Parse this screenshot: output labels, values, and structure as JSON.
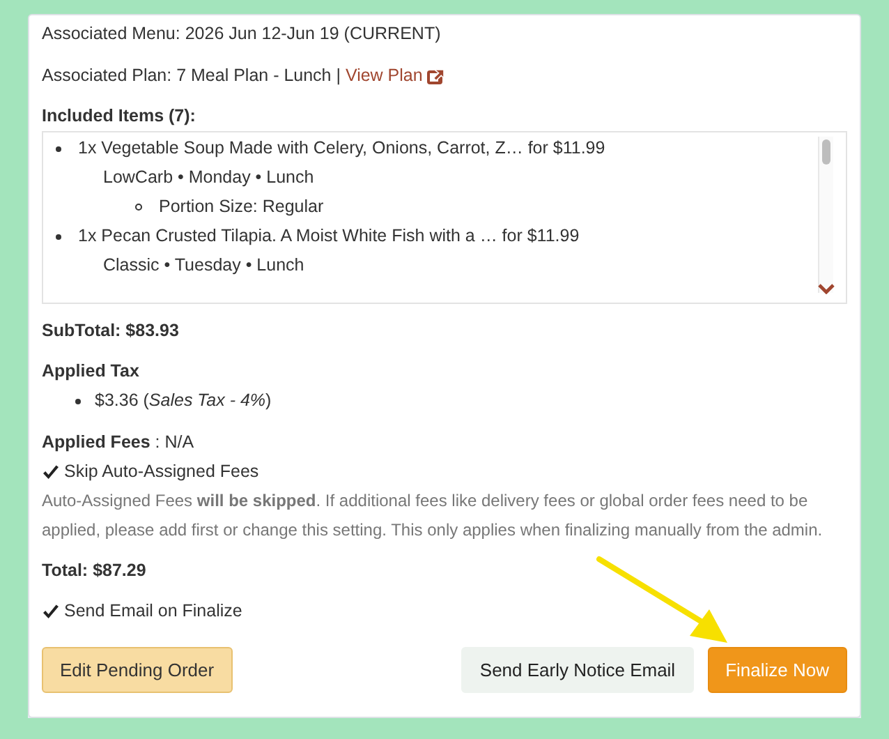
{
  "associated_menu": "Associated Menu: 2026 Jun 12-Jun 19 (CURRENT)",
  "associated_plan": {
    "text": "Associated Plan: 7 Meal Plan - Lunch |",
    "link": "View Plan"
  },
  "included_items": {
    "heading": "Included Items (7):",
    "items": [
      {
        "text": "1x Vegetable Soup Made with Celery, Onions, Carrot, Z… for $11.99",
        "details": "LowCarb • Monday • Lunch",
        "options": [
          "Portion Size: Regular"
        ]
      },
      {
        "text": "1x Pecan Crusted Tilapia. A Moist White Fish with a … for $11.99",
        "details": "Classic • Tuesday • Lunch"
      }
    ]
  },
  "subtotal": "SubTotal: $83.93",
  "applied_tax": {
    "heading": "Applied Tax",
    "items": [
      "$3.36 (*Sales Tax - 4%*)"
    ]
  },
  "applied_fees": "**Applied Fees** : N/A",
  "skip_fees": {
    "label": "Skip Auto-Assigned Fees",
    "checked": true
  },
  "skip_fees_note": "Auto-Assigned Fees **will be skipped**. If additional fees like delivery fees or global order fees need to be applied, please add first or change this setting. This only applies when finalizing manually from the admin.",
  "total": "Total: $87.29",
  "send_email": {
    "label": "Send Email on Finalize",
    "checked": true
  },
  "buttons": [
    {
      "label": "Edit Pending Order",
      "kind": "edit"
    },
    {
      "label": "Send Early Notice Email",
      "kind": "secondary"
    },
    {
      "label": "Finalize Now",
      "kind": "primary"
    }
  ]
}
